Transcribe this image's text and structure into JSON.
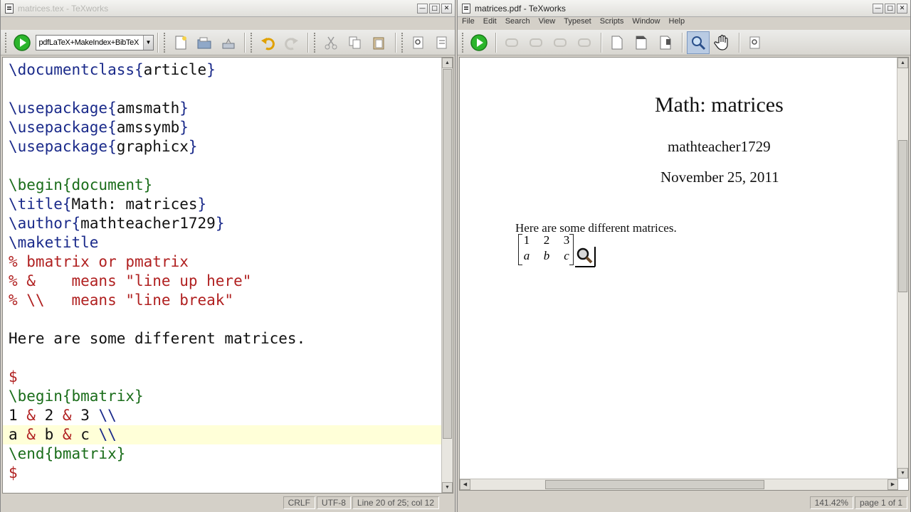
{
  "left_window": {
    "title": "matrices.tex - TeXworks",
    "engine": "pdfLaTeX+MakeIndex+BibTeX",
    "code_lines": [
      [
        {
          "t": "\\documentclass",
          "c": "cmd"
        },
        {
          "t": "{",
          "c": "brace"
        },
        {
          "t": "article",
          "c": "arg"
        },
        {
          "t": "}",
          "c": "brace"
        }
      ],
      [],
      [
        {
          "t": "\\usepackage",
          "c": "cmd"
        },
        {
          "t": "{",
          "c": "brace"
        },
        {
          "t": "amsmath",
          "c": "arg"
        },
        {
          "t": "}",
          "c": "brace"
        }
      ],
      [
        {
          "t": "\\usepackage",
          "c": "cmd"
        },
        {
          "t": "{",
          "c": "brace"
        },
        {
          "t": "amssymb",
          "c": "arg"
        },
        {
          "t": "}",
          "c": "brace"
        }
      ],
      [
        {
          "t": "\\usepackage",
          "c": "cmd"
        },
        {
          "t": "{",
          "c": "brace"
        },
        {
          "t": "graphicx",
          "c": "arg"
        },
        {
          "t": "}",
          "c": "brace"
        }
      ],
      [],
      [
        {
          "t": "\\begin{document}",
          "c": "env"
        }
      ],
      [
        {
          "t": "\\title",
          "c": "cmd"
        },
        {
          "t": "{",
          "c": "brace"
        },
        {
          "t": "Math: matrices",
          "c": "arg"
        },
        {
          "t": "}",
          "c": "brace"
        }
      ],
      [
        {
          "t": "\\author",
          "c": "cmd"
        },
        {
          "t": "{",
          "c": "brace"
        },
        {
          "t": "mathteacher1729",
          "c": "arg"
        },
        {
          "t": "}",
          "c": "brace"
        }
      ],
      [
        {
          "t": "\\maketitle",
          "c": "cmd"
        }
      ],
      [
        {
          "t": "% bmatrix or pmatrix",
          "c": "comment"
        }
      ],
      [
        {
          "t": "% &    means \"line up here\"",
          "c": "comment"
        }
      ],
      [
        {
          "t": "% \\\\   means \"line break\"",
          "c": "comment"
        }
      ],
      [],
      [
        {
          "t": "Here are some different matrices.",
          "c": "arg"
        }
      ],
      [],
      [
        {
          "t": "$",
          "c": "math"
        }
      ],
      [
        {
          "t": "\\begin{bmatrix}",
          "c": "env"
        }
      ],
      [
        {
          "t": "1 ",
          "c": "arg"
        },
        {
          "t": "&",
          "c": "math"
        },
        {
          "t": " 2 ",
          "c": "arg"
        },
        {
          "t": "&",
          "c": "math"
        },
        {
          "t": " 3 ",
          "c": "arg"
        },
        {
          "t": "\\\\",
          "c": "cmd"
        }
      ],
      [
        {
          "t": "a ",
          "c": "arg"
        },
        {
          "t": "&",
          "c": "math"
        },
        {
          "t": " b ",
          "c": "arg"
        },
        {
          "t": "&",
          "c": "math"
        },
        {
          "t": " c ",
          "c": "arg"
        },
        {
          "t": "\\\\",
          "c": "cmd"
        }
      ],
      [
        {
          "t": "\\end{bmatrix}",
          "c": "env"
        }
      ],
      [
        {
          "t": "$",
          "c": "math"
        }
      ]
    ],
    "current_line_index": 19,
    "status": {
      "line_ending": "CRLF",
      "encoding": "UTF-8",
      "position": "Line 20 of 25; col 12"
    }
  },
  "right_window": {
    "title": "matrices.pdf - TeXworks",
    "menu": [
      "File",
      "Edit",
      "Search",
      "View",
      "Typeset",
      "Scripts",
      "Window",
      "Help"
    ],
    "pdf": {
      "title": "Math: matrices",
      "author": "mathteacher1729",
      "date": "November 25, 2011",
      "body": "Here are some different matrices.",
      "matrix": [
        [
          "1",
          "2",
          "3"
        ],
        [
          "a",
          "b",
          "c"
        ]
      ]
    },
    "status": {
      "zoom": "141.42%",
      "page": "page 1 of 1"
    }
  },
  "icons": {
    "typeset": "typeset-play-icon",
    "new": "new-document-icon",
    "open": "open-folder-icon",
    "save": "save-icon",
    "undo": "undo-icon",
    "redo": "redo-icon",
    "cut": "cut-icon",
    "copy": "copy-icon",
    "paste": "paste-icon",
    "find": "find-icon",
    "replace": "replace-icon",
    "magnify": "magnify-icon",
    "hand": "hand-icon",
    "goto_source": "goto-source-icon"
  },
  "colors": {
    "command": "#1a2a8a",
    "environment": "#1a6d1a",
    "comment": "#b02020",
    "current_line": "#ffffd8",
    "typeset_button": "#2bb52b"
  }
}
